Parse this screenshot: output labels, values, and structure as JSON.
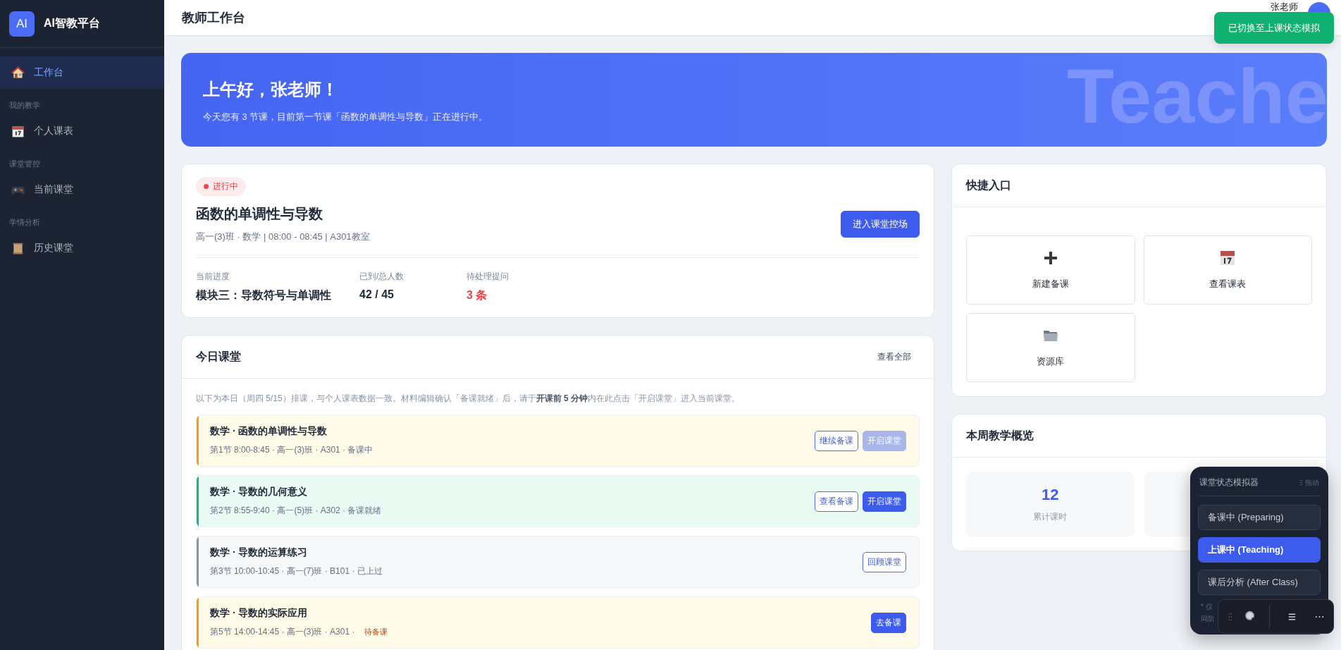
{
  "sidebar": {
    "logo": "AI",
    "brand": "AI智教平台",
    "nav": [
      {
        "kind": "item",
        "label": "工作台",
        "selected": true
      },
      {
        "kind": "heading",
        "label": "我的教学"
      },
      {
        "kind": "item",
        "label": "个人课表",
        "selected": false
      },
      {
        "kind": "heading",
        "label": "课堂管控"
      },
      {
        "kind": "item",
        "label": "当前课堂",
        "selected": false
      },
      {
        "kind": "heading",
        "label": "学情分析"
      },
      {
        "kind": "item",
        "label": "历史课堂",
        "selected": false
      }
    ]
  },
  "header": {
    "title": "教师工作台",
    "user": "张老师"
  },
  "toast": "已切换至上课状态模拟",
  "banner": {
    "greeting": "上午好，张老师！",
    "message": "今天您有 3 节课，目前第一节课「函数的单调性与导数」正在进行中。",
    "watermark": "Teache"
  },
  "current_class": {
    "badge": "进行中",
    "title": "函数的单调性与导数",
    "meta": "高一(3)班 · 数学 | 08:00 - 08:45 | A301教室",
    "button": "进入课堂控场",
    "stats": [
      {
        "label": "当前进度",
        "value": "模块三：导数符号与单调性",
        "kind": "normal"
      },
      {
        "label": "已到/总人数",
        "value": "42 / 45",
        "kind": "normal"
      },
      {
        "label": "待处理提问",
        "value": "3 条",
        "kind": "alert"
      }
    ]
  },
  "today": {
    "title": "今日课堂",
    "link": "查看全部",
    "note": "以下为本日（周四 5/15）排课，与个人课表数据一致。材料编辑确认「备课就绪」后，请于**开课前 5 分钟**内在此点击「开启课堂」进入当前课堂。",
    "lessons": [
      {
        "kind": "preparing",
        "color": "#f59e0b",
        "title": "数学 · 函数的单调性与导数",
        "meta": "第1节 8:00-8:45 · 高一(3)班 · A301 · 备课中",
        "buttons": [
          {
            "label": "继续备课",
            "kind": "outline"
          },
          {
            "label": "开启课堂",
            "kind": "disabled"
          }
        ]
      },
      {
        "kind": "ready",
        "color": "#10b981",
        "title": "数学 · 导数的几何意义",
        "meta": "第2节 8:55-9:40 · 高一(5)班 · A302 · 备课就绪",
        "buttons": [
          {
            "label": "查看备课",
            "kind": "outline"
          },
          {
            "label": "开启课堂",
            "kind": "primary"
          }
        ]
      },
      {
        "kind": "done",
        "color": "#8a94ad",
        "title": "数学 · 导数的运算练习",
        "meta": "第3节 10:00-10:45 · 高一(7)班 · B101 · 已上过",
        "buttons": [
          {
            "label": "回顾课堂",
            "kind": "outline"
          }
        ]
      },
      {
        "kind": "preparing",
        "color": "#f59e0b",
        "title": "数学 · 导数的实际应用",
        "meta": "第5节 14:00-14:45 · 高一(3)班 · A301 ·",
        "tag": "待备课",
        "buttons": [
          {
            "label": "去备课",
            "kind": "primary"
          }
        ]
      }
    ]
  },
  "quick": {
    "title": "快捷入口",
    "items": [
      {
        "label": "新建备课"
      },
      {
        "label": "查看课表"
      },
      {
        "label": "资源库"
      }
    ]
  },
  "overview": {
    "title": "本周教学概览",
    "stats": [
      {
        "value": "12",
        "label": "累计课时"
      }
    ]
  },
  "simulator": {
    "title": "课堂状态模拟器",
    "drag": "拖动",
    "options": [
      {
        "label": "备课中 (Preparing)",
        "selected": false
      },
      {
        "label": "上课中 (Teaching)",
        "selected": true
      },
      {
        "label": "课后分析 (After Class)",
        "selected": false
      }
    ],
    "footnote": [
      "* 仅",
      "同阶"
    ]
  }
}
